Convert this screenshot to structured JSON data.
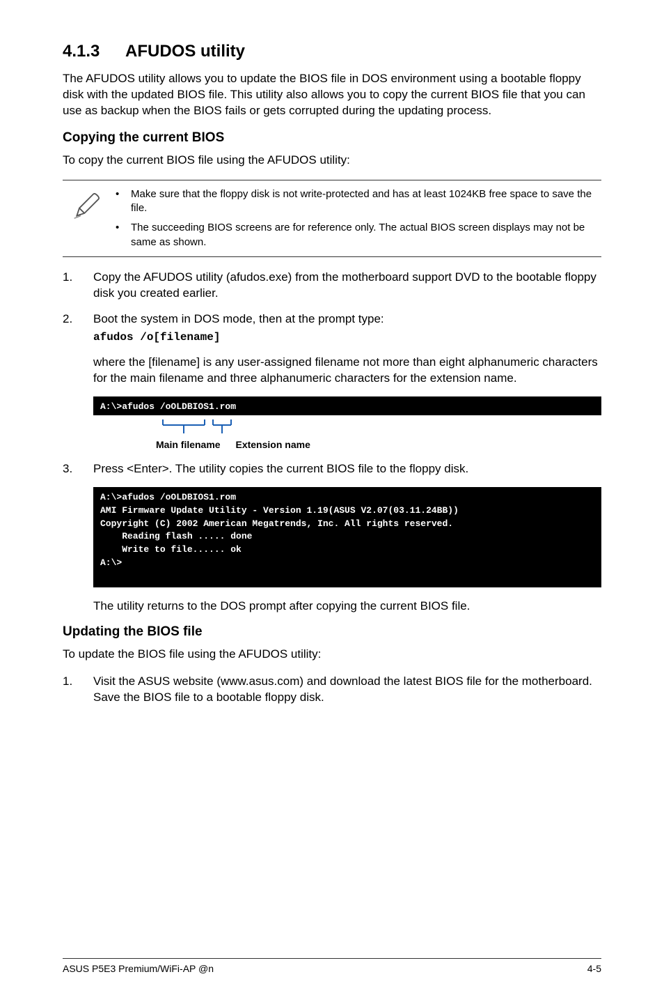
{
  "section": {
    "number": "4.1.3",
    "title": "AFUDOS utility"
  },
  "intro": "The AFUDOS utility allows you to update the BIOS file in DOS environment using a bootable floppy disk with the updated BIOS file. This utility also allows you to copy the current BIOS file that you can use as backup when the BIOS fails or gets corrupted during the updating process.",
  "copy": {
    "heading": "Copying the current BIOS",
    "lead": "To copy the current BIOS file using the AFUDOS utility:",
    "notes": [
      "Make sure that the floppy disk is not write-protected and has at least 1024KB free space to save the file.",
      "The succeeding BIOS screens are for reference only. The actual BIOS screen displays may not be same as shown."
    ],
    "steps": [
      "Copy the AFUDOS utility (afudos.exe) from the motherboard support DVD to the bootable floppy disk you created earlier.",
      "Boot the system in DOS mode, then at the prompt type:"
    ],
    "cmd": "afudos /o[filename]",
    "where": "where the [filename] is any user-assigned filename not more than eight alphanumeric characters  for the main filename and three alphanumeric characters for the extension name.",
    "terminal1": "A:\\>afudos /oOLDBIOS1.rom",
    "fn_main_label": "Main filename",
    "fn_ext_label": "Extension name",
    "step3": "Press <Enter>. The utility copies the current BIOS file to the floppy disk.",
    "terminal2": "A:\\>afudos /oOLDBIOS1.rom\nAMI Firmware Update Utility - Version 1.19(ASUS V2.07(03.11.24BB))\nCopyright (C) 2002 American Megatrends, Inc. All rights reserved.\n    Reading flash ..... done\n    Write to file...... ok\nA:\\>\n ",
    "after": "The utility returns to the DOS prompt after copying the current BIOS file."
  },
  "update": {
    "heading": "Updating the BIOS file",
    "lead": "To update the BIOS file using the AFUDOS utility:",
    "step1": "Visit the ASUS website (www.asus.com) and download the latest BIOS file for the motherboard. Save the BIOS file to a bootable floppy disk."
  },
  "footer": {
    "left": "ASUS P5E3 Premium/WiFi-AP @n",
    "right": "4-5"
  }
}
